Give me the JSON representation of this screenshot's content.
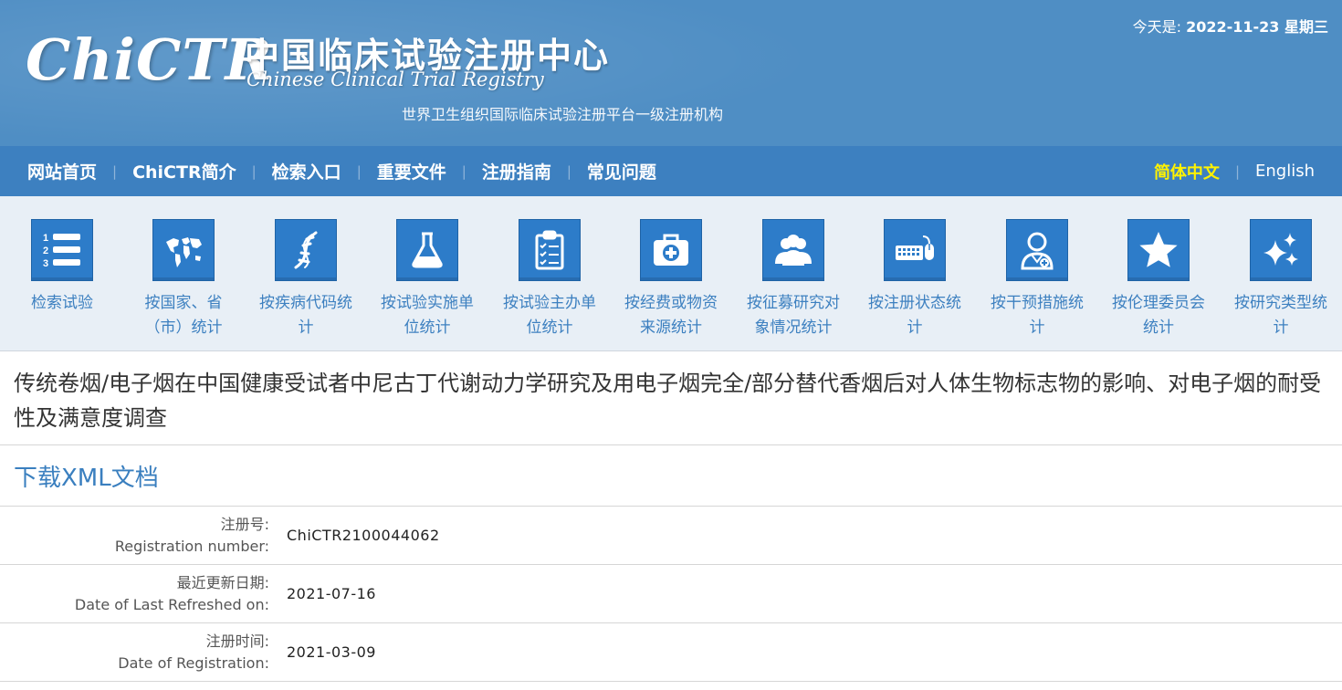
{
  "header": {
    "logo_text": "ChiCTR",
    "org_name_cn": "中国临床试验注册中心",
    "org_name_en": "Chinese Clinical Trial Registry",
    "subtitle": "世界卫生组织国际临床试验注册平台一级注册机构",
    "date_label": "今天是:",
    "date_value": "2022-11-23 星期三"
  },
  "nav": {
    "items": [
      "网站首页",
      "ChiCTR简介",
      "检索入口",
      "重要文件",
      "注册指南",
      "常见问题"
    ],
    "lang_cn": "简体中文",
    "lang_en": "English"
  },
  "icon_bar": [
    {
      "icon": "numbered-list-icon",
      "label_1": "检索试验",
      "label_2": ""
    },
    {
      "icon": "world-map-icon",
      "label_1": "按国家、省",
      "label_2": "（市）统计"
    },
    {
      "icon": "dna-icon",
      "label_1": "按疾病代码统",
      "label_2": "计"
    },
    {
      "icon": "flask-icon",
      "label_1": "按试验实施单",
      "label_2": "位统计"
    },
    {
      "icon": "clipboard-icon",
      "label_1": "按试验主办单",
      "label_2": "位统计"
    },
    {
      "icon": "medical-kit-icon",
      "label_1": "按经费或物资",
      "label_2": "来源统计"
    },
    {
      "icon": "people-icon",
      "label_1": "按征募研究对",
      "label_2": "象情况统计"
    },
    {
      "icon": "keyboard-mouse-icon",
      "label_1": "按注册状态统",
      "label_2": "计"
    },
    {
      "icon": "doctor-icon",
      "label_1": "按干预措施统",
      "label_2": "计"
    },
    {
      "icon": "star-icon",
      "label_1": "按伦理委员会",
      "label_2": "统计"
    },
    {
      "icon": "sparkles-icon",
      "label_1": "按研究类型统",
      "label_2": "计"
    }
  ],
  "study": {
    "title": "传统卷烟/电子烟在中国健康受试者中尼古丁代谢动力学研究及用电子烟完全/部分替代香烟后对人体生物标志物的影响、对电子烟的耐受性及满意度调查",
    "xml_link": "下载XML文档",
    "fields": [
      {
        "label_cn": "注册号:",
        "label_en": "Registration number:",
        "value": "ChiCTR2100044062"
      },
      {
        "label_cn": "最近更新日期:",
        "label_en": "Date of Last Refreshed on:",
        "value": "2021-07-16"
      },
      {
        "label_cn": "注册时间:",
        "label_en": "Date of Registration:",
        "value": "2021-03-09"
      }
    ]
  },
  "colors": {
    "header_bg": "#4f8ec4",
    "nav_bg": "#3d80c0",
    "icon_box": "#2d7cc9",
    "link": "#3a7fbf",
    "lang_active": "#fff200"
  }
}
